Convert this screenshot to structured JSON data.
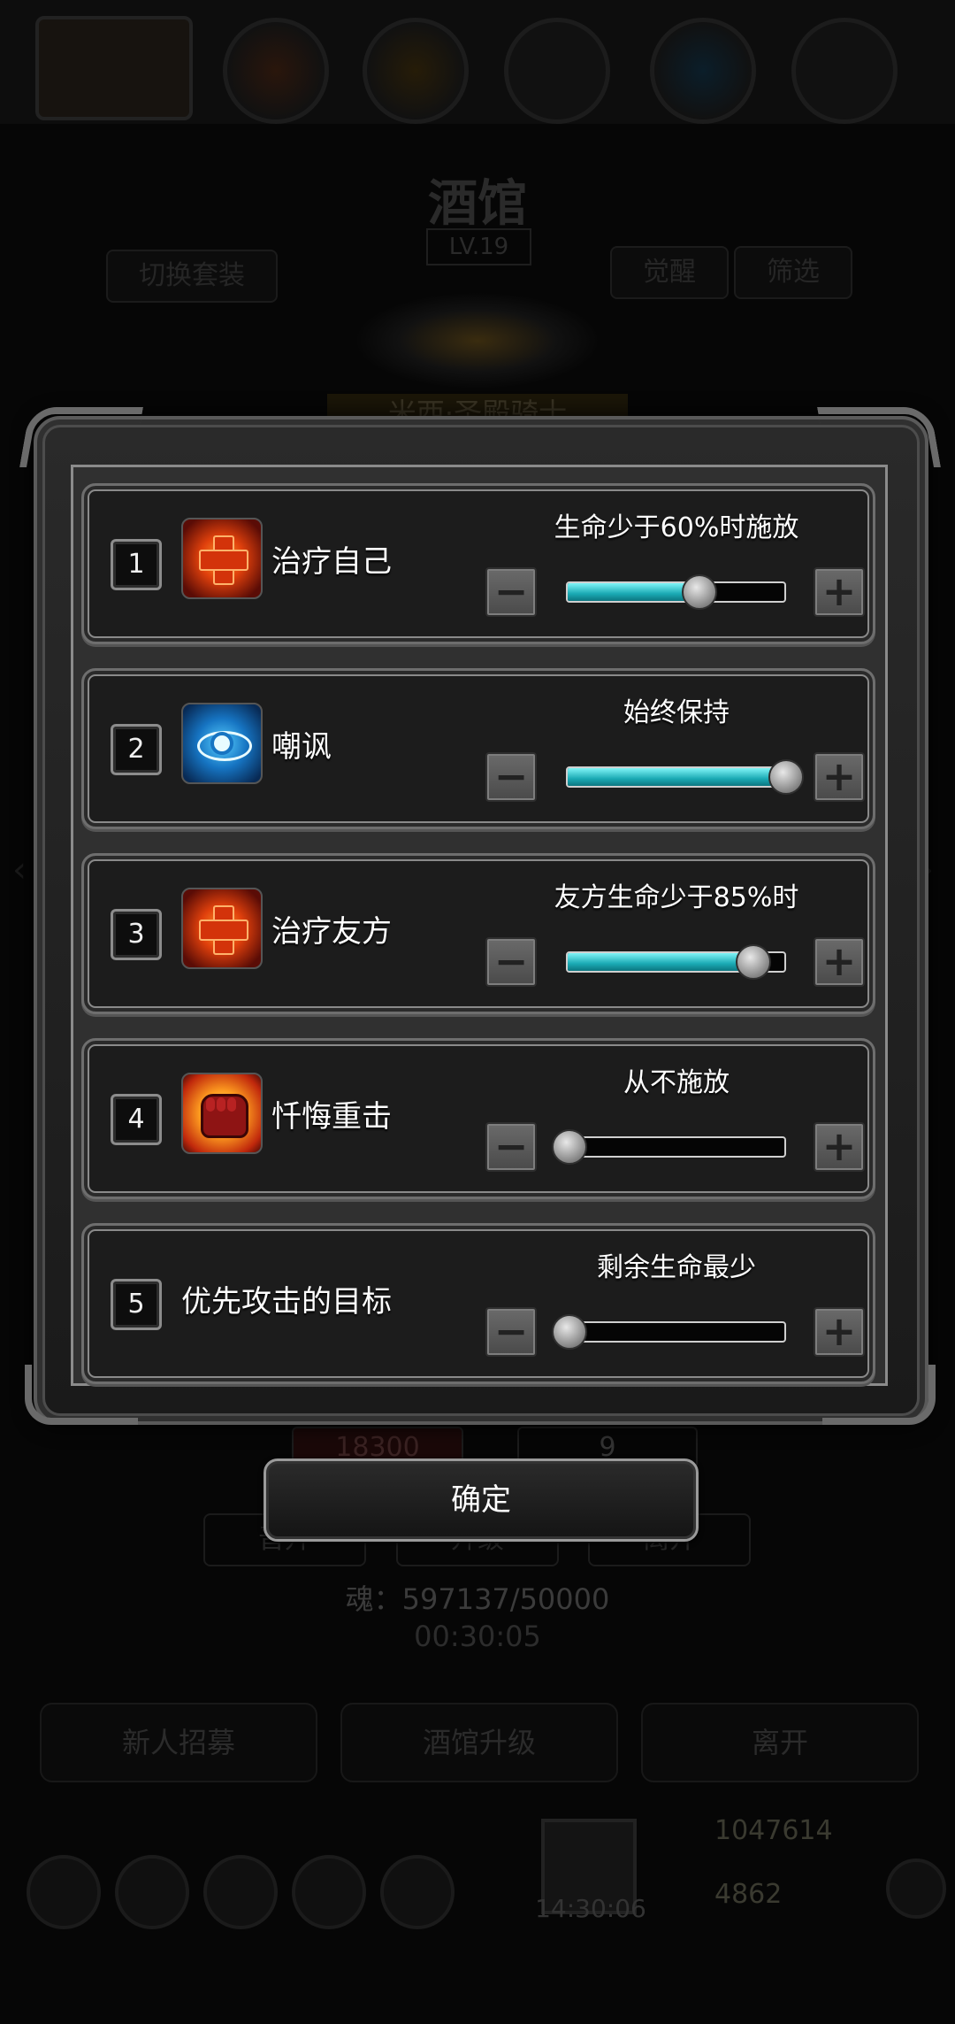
{
  "background": {
    "title": "酒馆",
    "level": "LV.19",
    "left_button": "切换套装",
    "awaken_button": "觉醒",
    "filter_button": "筛选",
    "hero_name": "米西·圣殿骑士",
    "stat_hp": "18300",
    "stat_energy": "9",
    "tab_labels": [
      "晋升",
      "升级",
      "离开"
    ],
    "soul": "魂：597137/50000",
    "timer": "00:30:05",
    "actions": [
      "新人招募",
      "酒馆升级",
      "离开"
    ],
    "gift_timer": "14:30:06",
    "gold": "1047614",
    "gems": "4862"
  },
  "dialog": {
    "rows": [
      {
        "index": "1",
        "icon": "heal-icon",
        "name": "治疗自己",
        "condition": "生命少于60%时施放",
        "level": 0.6
      },
      {
        "index": "2",
        "icon": "taunt-eye-icon",
        "name": "嘲讽",
        "condition": "始终保持",
        "level": 1.0
      },
      {
        "index": "3",
        "icon": "heal-icon",
        "name": "治疗友方",
        "condition": "友方生命少于85%时",
        "level": 0.85
      },
      {
        "index": "4",
        "icon": "fist-icon",
        "name": "忏悔重击",
        "condition": "从不施放",
        "level": 0.0
      },
      {
        "index": "5",
        "icon": "",
        "name": "优先攻击的目标",
        "condition": "剩余生命最少",
        "level": 0.0
      }
    ],
    "minus_label": "−",
    "plus_label": "+",
    "confirm_label": "确定"
  },
  "colors": {
    "slider_fill": "#1aa9b3",
    "frame": "#6e6e6e"
  }
}
